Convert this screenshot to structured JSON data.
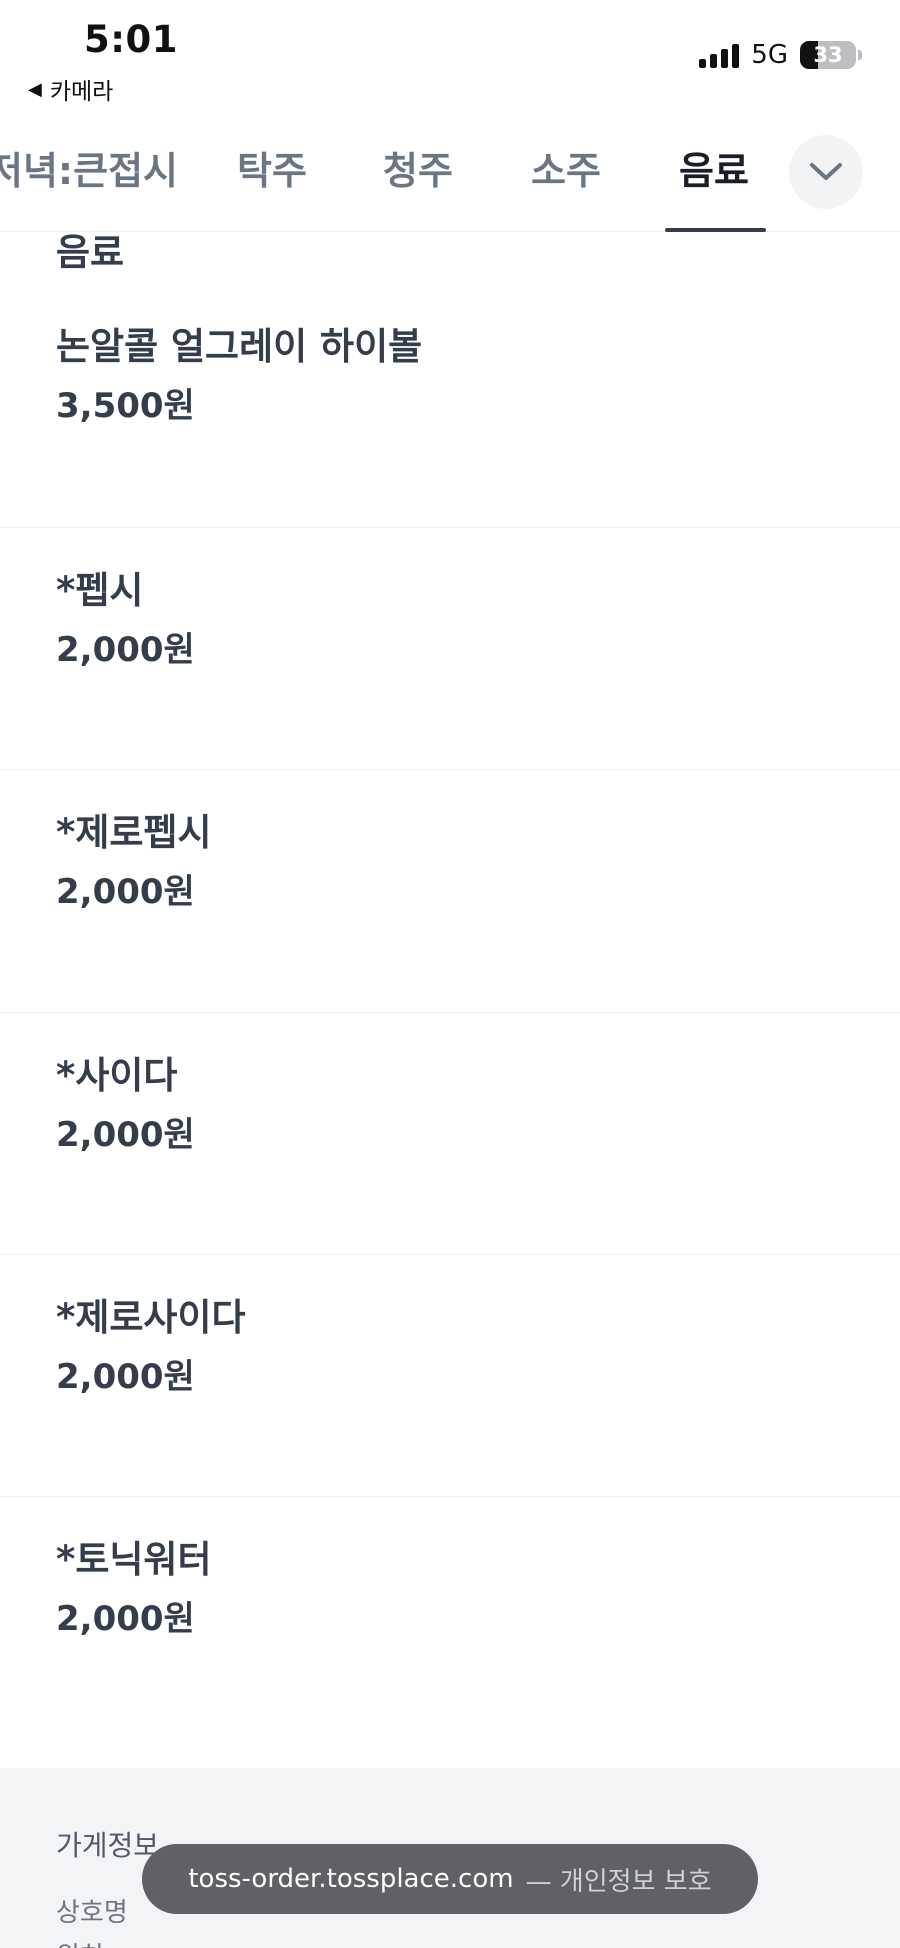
{
  "status": {
    "time": "5:01",
    "back_app": "카메라",
    "network": "5G",
    "battery": "33"
  },
  "tabs": [
    {
      "label": "저녁:큰접시",
      "active": false
    },
    {
      "label": "탁주",
      "active": false
    },
    {
      "label": "청주",
      "active": false
    },
    {
      "label": "소주",
      "active": false
    },
    {
      "label": "음료",
      "active": true
    }
  ],
  "section": {
    "title": "음료"
  },
  "menu": [
    {
      "name": "논알콜 얼그레이 하이볼",
      "price": "3,500원"
    },
    {
      "name": "*펩시",
      "price": "2,000원"
    },
    {
      "name": "*제로펩시",
      "price": "2,000원"
    },
    {
      "name": "*사이다",
      "price": "2,000원"
    },
    {
      "name": "*제로사이다",
      "price": "2,000원"
    },
    {
      "name": "*토닉워터",
      "price": "2,000원"
    }
  ],
  "footer": {
    "title": "가게정보",
    "row1": "상호명",
    "row2": "위치"
  },
  "url_bar": {
    "host": "toss-order.tossplace.com",
    "note": "— 개인정보 보호"
  },
  "colors": {
    "text_primary": "#333d4b",
    "tab_inactive": "#6b7684",
    "footer_bg": "#f2f4f6",
    "toast_bg": "#5f6166"
  }
}
